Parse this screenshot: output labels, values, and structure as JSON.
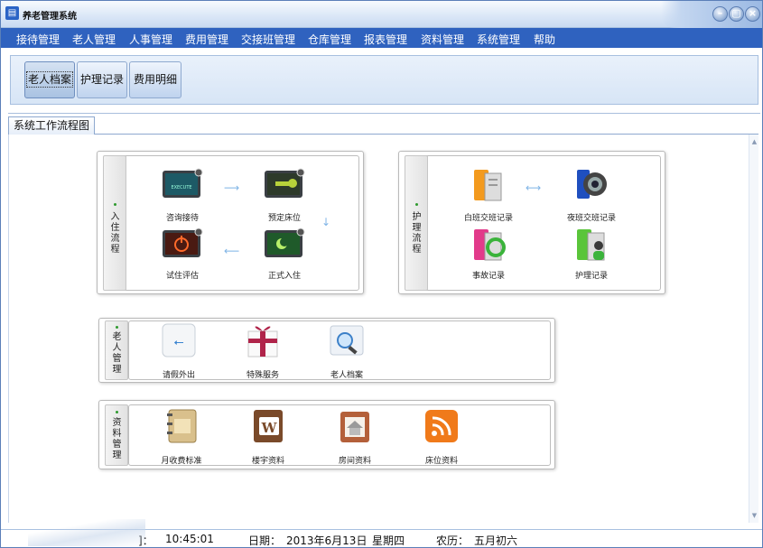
{
  "window": {
    "title": "养老管理系统",
    "buttons": {
      "minimize": "–",
      "restore": "▢",
      "close": "×"
    }
  },
  "menu": [
    "接待管理",
    "老人管理",
    "人事管理",
    "费用管理",
    "交接班管理",
    "仓库管理",
    "报表管理",
    "资料管理",
    "系统管理",
    "帮助"
  ],
  "toolbar": [
    "老人档案",
    "护理记录",
    "费用明细"
  ],
  "tab": "系统工作流程图",
  "groups": {
    "checkin": {
      "label": [
        "入",
        "住",
        "流",
        "程"
      ],
      "items": [
        "咨询接待",
        "预定床位",
        "试住评估",
        "正式入住"
      ]
    },
    "nursing": {
      "label": [
        "护",
        "理",
        "流",
        "程"
      ],
      "items": [
        "白班交班记录",
        "夜班交班记录",
        "事故记录",
        "护理记录"
      ]
    },
    "elder": {
      "label": [
        "老",
        "人",
        "管",
        "理"
      ],
      "items": [
        "请假外出",
        "特殊服务",
        "老人档案"
      ]
    },
    "data": {
      "label": [
        "资",
        "料",
        "管",
        "理"
      ],
      "items": [
        "月收费标准",
        "楼宇资料",
        "房间资料",
        "床位资料"
      ]
    }
  },
  "status": {
    "time_label": "]：",
    "time": "10:45:01",
    "date_label": "日期：",
    "date": "2013年6月13日",
    "weekday": "星期四",
    "lunar_label": "农历：",
    "lunar": "五月初六"
  },
  "colors": {
    "menubar": "#2f62bf",
    "accent_green": "#2f9a2f",
    "arrow": "#7fb4e6"
  },
  "icons": [
    "monitor-execute-icon",
    "monitor-key-icon",
    "monitor-power-icon",
    "monitor-moon-icon",
    "binder-day-icon",
    "webcam-night-icon",
    "binder-cycle-icon",
    "binder-user-icon",
    "usb-box-icon",
    "gift-icon",
    "search-folder-icon",
    "notebook-icon",
    "book-w-icon",
    "house-folder-icon",
    "rss-icon"
  ]
}
